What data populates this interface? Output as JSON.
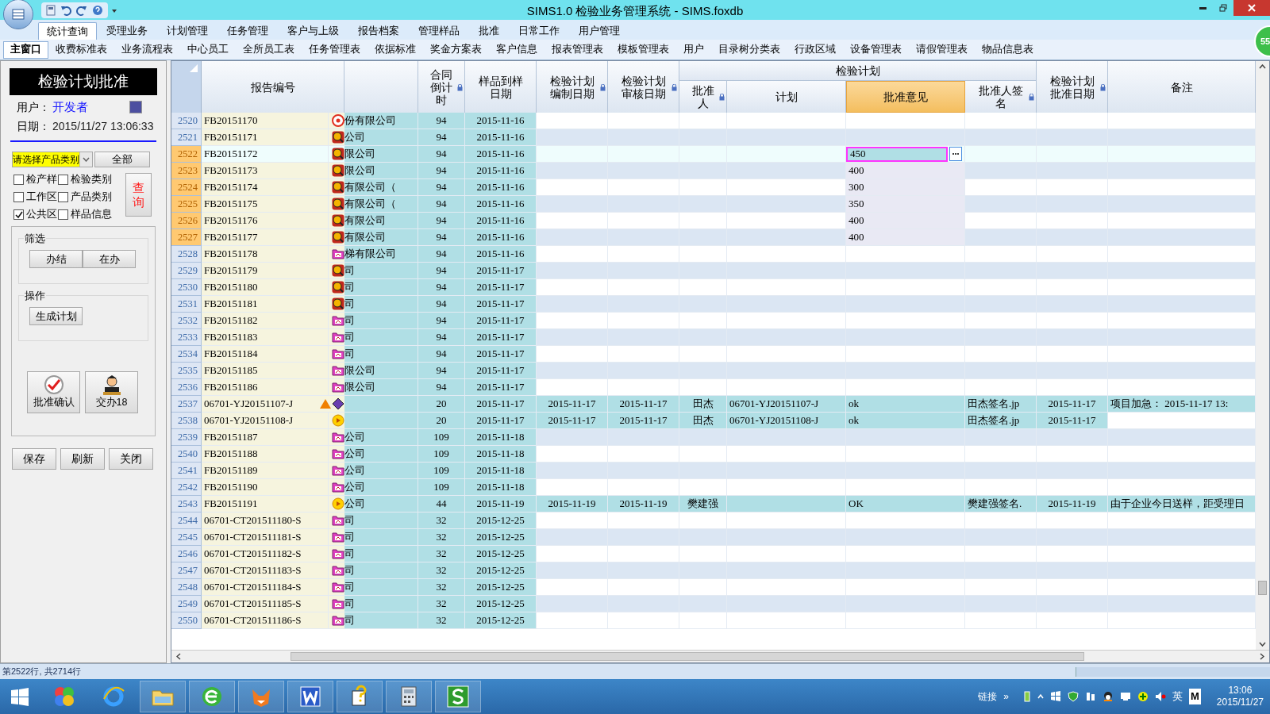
{
  "window": {
    "title": "SIMS1.0 检验业务管理系统 - SIMS.foxdb",
    "badge": "55"
  },
  "menu_tabs": [
    {
      "label": "统计查询",
      "selected": true
    },
    {
      "label": "受理业务",
      "selected": false
    },
    {
      "label": "计划管理",
      "selected": false
    },
    {
      "label": "任务管理",
      "selected": false
    },
    {
      "label": "客户与上级",
      "selected": false
    },
    {
      "label": "报告档案",
      "selected": false
    },
    {
      "label": "管理样品",
      "selected": false
    },
    {
      "label": "批准",
      "selected": false
    },
    {
      "label": "日常工作",
      "selected": false
    },
    {
      "label": "用户管理",
      "selected": false
    }
  ],
  "window_tabs": [
    {
      "label": "主窗口",
      "selected": true
    },
    {
      "label": "收费标准表",
      "selected": false
    },
    {
      "label": "业务流程表",
      "selected": false
    },
    {
      "label": "中心员工",
      "selected": false
    },
    {
      "label": "全所员工表",
      "selected": false
    },
    {
      "label": "任务管理表",
      "selected": false
    },
    {
      "label": "依据标准",
      "selected": false
    },
    {
      "label": "奖金方案表",
      "selected": false
    },
    {
      "label": "客户信息",
      "selected": false
    },
    {
      "label": "报表管理表",
      "selected": false
    },
    {
      "label": "模板管理表",
      "selected": false
    },
    {
      "label": "用户",
      "selected": false
    },
    {
      "label": "目录树分类表",
      "selected": false
    },
    {
      "label": "行政区域",
      "selected": false
    },
    {
      "label": "设备管理表",
      "selected": false
    },
    {
      "label": "请假管理表",
      "selected": false
    },
    {
      "label": "物品信息表",
      "selected": false
    }
  ],
  "side_panel": {
    "title": "检验计划批准",
    "user_label": "用户：",
    "user": "开发者",
    "date_label": "日期：",
    "date": "2015/11/27 13:06:33",
    "category_select": {
      "value": "请选择产品类别"
    },
    "all_button": "全部",
    "checkboxes": [
      {
        "label": "检产样",
        "checked": false
      },
      {
        "label": "检验类别",
        "checked": false
      },
      {
        "label": "工作区",
        "checked": false
      },
      {
        "label": "产品类别",
        "checked": false
      },
      {
        "label": "公共区",
        "checked": true
      },
      {
        "label": "样品信息",
        "checked": false
      }
    ],
    "query_button": "查询",
    "filter": {
      "legend": "筛选",
      "buttons": [
        "办结",
        "在办"
      ]
    },
    "operation": {
      "legend": "操作",
      "buttons": [
        "生成计划"
      ]
    },
    "action_buttons": [
      {
        "kind": "check",
        "label": "批准确认"
      },
      {
        "kind": "person",
        "label": "交办18"
      }
    ],
    "bottom_buttons": [
      "保存",
      "刷新",
      "关闭"
    ]
  },
  "table": {
    "group_label": "检验计划",
    "columns": [
      {
        "label": "报告编号",
        "locked": false,
        "in_group": false,
        "selected": false
      },
      {
        "locked": false,
        "in_group": false,
        "selected": false
      },
      {
        "label": "合同倒计时",
        "locked": true,
        "in_group": false,
        "selected": false
      },
      {
        "label": "样品到样日期",
        "locked": false,
        "in_group": false,
        "selected": false
      },
      {
        "label": "检验计划编制日期",
        "locked": true,
        "in_group": false,
        "selected": false
      },
      {
        "label": "检验计划审核日期",
        "locked": true,
        "in_group": false,
        "selected": false
      },
      {
        "label": "批准人",
        "locked": true,
        "in_group": true,
        "selected": false
      },
      {
        "label": "计划",
        "locked": false,
        "in_group": true,
        "selected": false
      },
      {
        "label": "批准意见",
        "locked": false,
        "in_group": true,
        "selected": true
      },
      {
        "label": "批准人签名",
        "locked": true,
        "in_group": true,
        "selected": false
      },
      {
        "label": "检验计划批准日期",
        "locked": true,
        "in_group": false,
        "selected": false
      },
      {
        "label": "备注",
        "locked": false,
        "in_group": false,
        "selected": false
      }
    ],
    "rows": [
      {
        "no": "2520",
        "cells": [
          "FB20151170",
          "份有限公司",
          "94",
          "2015-11-16"
        ],
        "kind": "target",
        "selected": false,
        "current": false,
        "highlighted": false
      },
      {
        "no": "2521",
        "cells": [
          "FB20151171",
          "公司",
          "94",
          "2015-11-16"
        ],
        "kind": "search",
        "selected": false,
        "current": false,
        "highlighted": false
      },
      {
        "no": "2522",
        "cells": [
          "FB20151172",
          "限公司",
          "94",
          "2015-11-16",
          null,
          null,
          null,
          null,
          "450"
        ],
        "kind": "search",
        "selected": true,
        "current": true,
        "highlighted": false
      },
      {
        "no": "2523",
        "cells": [
          "FB20151173",
          "限公司",
          "94",
          "2015-11-16",
          null,
          null,
          null,
          null,
          "400"
        ],
        "kind": "search",
        "selected": true,
        "current": false,
        "highlighted": false
      },
      {
        "no": "2524",
        "cells": [
          "FB20151174",
          "有限公司（",
          "94",
          "2015-11-16",
          null,
          null,
          null,
          null,
          "300"
        ],
        "kind": "search",
        "selected": true,
        "current": false,
        "highlighted": false
      },
      {
        "no": "2525",
        "cells": [
          "FB20151175",
          "有限公司（",
          "94",
          "2015-11-16",
          null,
          null,
          null,
          null,
          "350"
        ],
        "kind": "search",
        "selected": true,
        "current": false,
        "highlighted": false
      },
      {
        "no": "2526",
        "cells": [
          "FB20151176",
          "有限公司",
          "94",
          "2015-11-16",
          null,
          null,
          null,
          null,
          "400"
        ],
        "kind": "search",
        "selected": true,
        "current": false,
        "highlighted": false
      },
      {
        "no": "2527",
        "cells": [
          "FB20151177",
          "有限公司",
          "94",
          "2015-11-16",
          null,
          null,
          null,
          null,
          "400"
        ],
        "kind": "search",
        "selected": true,
        "current": false,
        "highlighted": false
      },
      {
        "no": "2528",
        "cells": [
          "FB20151178",
          "梯有限公司",
          "94",
          "2015-11-16"
        ],
        "kind": "folder",
        "selected": false,
        "current": false,
        "highlighted": false
      },
      {
        "no": "2529",
        "cells": [
          "FB20151179",
          "司",
          "94",
          "2015-11-17"
        ],
        "kind": "search",
        "selected": false,
        "current": false,
        "highlighted": false
      },
      {
        "no": "2530",
        "cells": [
          "FB20151180",
          "司",
          "94",
          "2015-11-17"
        ],
        "kind": "search",
        "selected": false,
        "current": false,
        "highlighted": false
      },
      {
        "no": "2531",
        "cells": [
          "FB20151181",
          "司",
          "94",
          "2015-11-17"
        ],
        "kind": "search",
        "selected": false,
        "current": false,
        "highlighted": false
      },
      {
        "no": "2532",
        "cells": [
          "FB20151182",
          "司",
          "94",
          "2015-11-17"
        ],
        "kind": "folder",
        "selected": false,
        "current": false,
        "highlighted": false
      },
      {
        "no": "2533",
        "cells": [
          "FB20151183",
          "司",
          "94",
          "2015-11-17"
        ],
        "kind": "folder",
        "selected": false,
        "current": false,
        "highlighted": false
      },
      {
        "no": "2534",
        "cells": [
          "FB20151184",
          "司",
          "94",
          "2015-11-17"
        ],
        "kind": "folder",
        "selected": false,
        "current": false,
        "highlighted": false
      },
      {
        "no": "2535",
        "cells": [
          "FB20151185",
          "限公司",
          "94",
          "2015-11-17"
        ],
        "kind": "folder",
        "selected": false,
        "current": false,
        "highlighted": false
      },
      {
        "no": "2536",
        "cells": [
          "FB20151186",
          "限公司",
          "94",
          "2015-11-17"
        ],
        "kind": "folder",
        "selected": false,
        "current": false,
        "highlighted": false
      },
      {
        "no": "2537",
        "cells": [
          "06701-YJ20151107-J",
          null,
          "20",
          "2015-11-17",
          "2015-11-17",
          "2015-11-17",
          "田杰",
          "06701-YJ20151107-J",
          "ok",
          "田杰签名.jp",
          "2015-11-17",
          "项目加急：  2015-11-17 13:"
        ],
        "kind": "urgent",
        "selected": false,
        "current": false,
        "highlighted": true
      },
      {
        "no": "2538",
        "cells": [
          "06701-YJ20151108-J",
          null,
          "20",
          "2015-11-17",
          "2015-11-17",
          "2015-11-17",
          "田杰",
          "06701-YJ20151108-J",
          "ok",
          "田杰签名.jp",
          "2015-11-17"
        ],
        "kind": "play",
        "selected": false,
        "current": false,
        "highlighted": true
      },
      {
        "no": "2539",
        "cells": [
          "FB20151187",
          "公司",
          "109",
          "2015-11-18"
        ],
        "kind": "folder",
        "selected": false,
        "current": false,
        "highlighted": false
      },
      {
        "no": "2540",
        "cells": [
          "FB20151188",
          "公司",
          "109",
          "2015-11-18"
        ],
        "kind": "folder",
        "selected": false,
        "current": false,
        "highlighted": false
      },
      {
        "no": "2541",
        "cells": [
          "FB20151189",
          "公司",
          "109",
          "2015-11-18"
        ],
        "kind": "folder",
        "selected": false,
        "current": false,
        "highlighted": false
      },
      {
        "no": "2542",
        "cells": [
          "FB20151190",
          "公司",
          "109",
          "2015-11-18"
        ],
        "kind": "folder",
        "selected": false,
        "current": false,
        "highlighted": false
      },
      {
        "no": "2543",
        "cells": [
          "FB20151191",
          "公司",
          "44",
          "2015-11-19",
          "2015-11-19",
          "2015-11-19",
          "樊建强",
          null,
          "OK",
          "樊建强签名.",
          "2015-11-19",
          "由于企业今日送样，距受理日"
        ],
        "kind": "play",
        "selected": false,
        "current": false,
        "highlighted": true
      },
      {
        "no": "2544",
        "cells": [
          "06701-CT201511180-S",
          "司",
          "32",
          "2015-12-25"
        ],
        "kind": "folder",
        "selected": false,
        "current": false,
        "highlighted": false
      },
      {
        "no": "2545",
        "cells": [
          "06701-CT201511181-S",
          "司",
          "32",
          "2015-12-25"
        ],
        "kind": "folder",
        "selected": false,
        "current": false,
        "highlighted": false
      },
      {
        "no": "2546",
        "cells": [
          "06701-CT201511182-S",
          "司",
          "32",
          "2015-12-25"
        ],
        "kind": "folder",
        "selected": false,
        "current": false,
        "highlighted": false
      },
      {
        "no": "2547",
        "cells": [
          "06701-CT201511183-S",
          "司",
          "32",
          "2015-12-25"
        ],
        "kind": "folder",
        "selected": false,
        "current": false,
        "highlighted": false
      },
      {
        "no": "2548",
        "cells": [
          "06701-CT201511184-S",
          "司",
          "32",
          "2015-12-25"
        ],
        "kind": "folder",
        "selected": false,
        "current": false,
        "highlighted": false
      },
      {
        "no": "2549",
        "cells": [
          "06701-CT201511185-S",
          "司",
          "32",
          "2015-12-25"
        ],
        "kind": "folder",
        "selected": false,
        "current": false,
        "highlighted": false
      },
      {
        "no": "2550",
        "cells": [
          "06701-CT201511186-S",
          "司",
          "32",
          "2015-12-25"
        ],
        "kind": "folder",
        "selected": false,
        "current": false,
        "highlighted": false
      }
    ]
  },
  "status_bar": {
    "text": "第2522行, 共2714行"
  },
  "taskbar": {
    "apps": [
      {
        "kind": "colorful"
      },
      {
        "kind": "ie"
      },
      {
        "kind": "folder"
      },
      {
        "kind": "green-e"
      },
      {
        "kind": "fox"
      },
      {
        "kind": "word"
      },
      {
        "kind": "help"
      },
      {
        "kind": "calculator"
      },
      {
        "kind": "s-app"
      }
    ],
    "links_label": "链接",
    "links_more": "»",
    "ime": "英",
    "ime_mode": "M",
    "time": "13:06",
    "date": "2015/11/27"
  }
}
